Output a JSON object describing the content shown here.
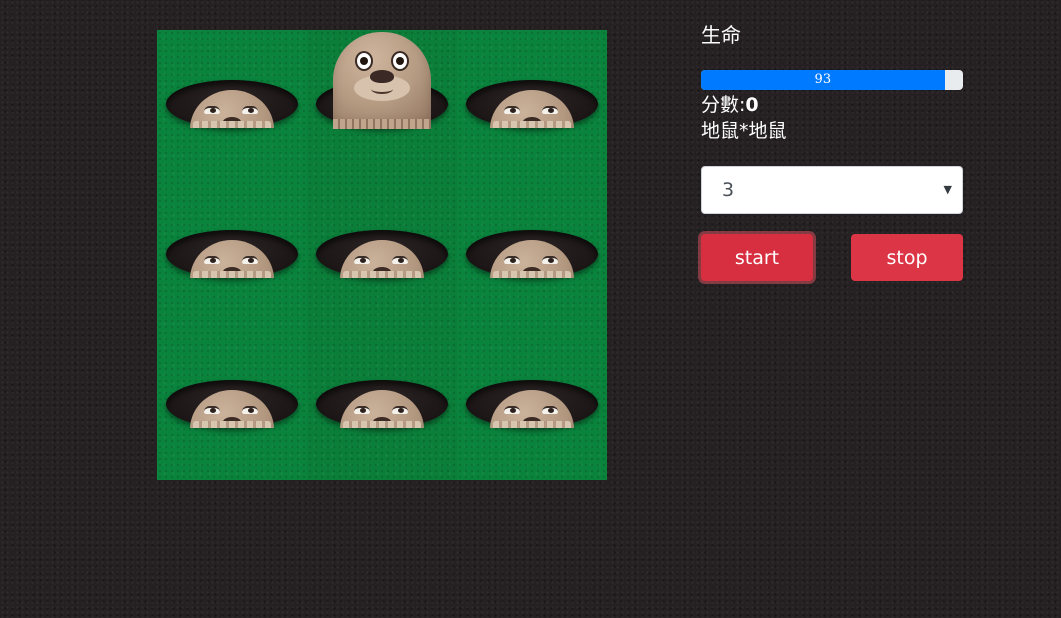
{
  "game": {
    "grid_rows": 3,
    "grid_cols": 3,
    "holes": [
      {
        "row": 0,
        "col": 0,
        "state": "peeking"
      },
      {
        "row": 0,
        "col": 1,
        "state": "up"
      },
      {
        "row": 0,
        "col": 2,
        "state": "peeking"
      },
      {
        "row": 1,
        "col": 0,
        "state": "peeking"
      },
      {
        "row": 1,
        "col": 1,
        "state": "peeking"
      },
      {
        "row": 1,
        "col": 2,
        "state": "peeking"
      },
      {
        "row": 2,
        "col": 0,
        "state": "peeking"
      },
      {
        "row": 2,
        "col": 1,
        "state": "peeking"
      },
      {
        "row": 2,
        "col": 2,
        "state": "peeking"
      }
    ],
    "colors": {
      "grass": "#0a843d",
      "hole": "#1e1818",
      "mole": "#b69b83"
    }
  },
  "panel": {
    "life_label": "生命",
    "life_value": "93",
    "life_percent": 93,
    "score_label": "分數:",
    "score_value": "0",
    "mode_text": "地鼠*地鼠",
    "level_select": {
      "selected": "3"
    },
    "start_label": "start",
    "stop_label": "stop"
  },
  "colors": {
    "background": "#252021",
    "progress": "#007bff",
    "button": "#dc3545"
  }
}
